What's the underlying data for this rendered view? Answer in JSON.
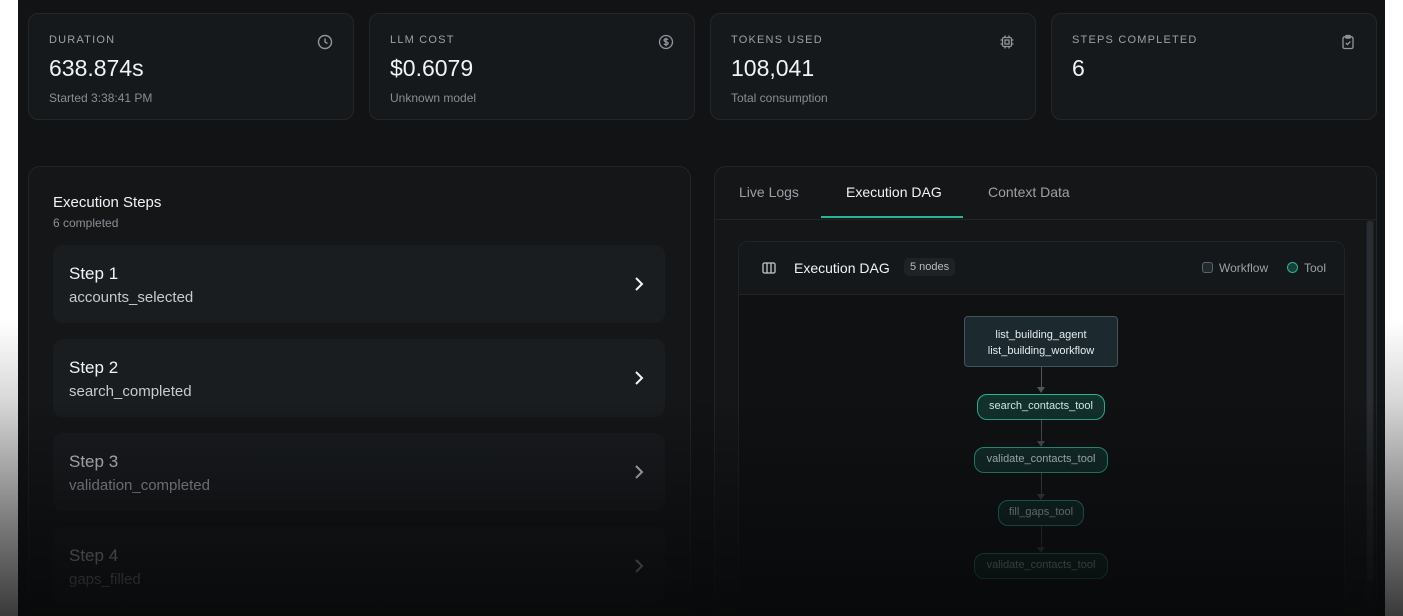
{
  "stats": [
    {
      "label": "DURATION",
      "value": "638.874s",
      "sub": "Started 3:38:41 PM",
      "icon": "clock-icon"
    },
    {
      "label": "LLM COST",
      "value": "$0.6079",
      "sub": "Unknown model",
      "icon": "dollar-icon"
    },
    {
      "label": "TOKENS USED",
      "value": "108,041",
      "sub": "Total consumption",
      "icon": "cpu-icon"
    },
    {
      "label": "STEPS COMPLETED",
      "value": "6",
      "sub": "",
      "icon": "clipboard-check-icon"
    }
  ],
  "steps_panel": {
    "title": "Execution Steps",
    "subtitle": "6 completed",
    "steps": [
      {
        "title": "Step 1",
        "sub": "accounts_selected"
      },
      {
        "title": "Step 2",
        "sub": "search_completed"
      },
      {
        "title": "Step 3",
        "sub": "validation_completed"
      },
      {
        "title": "Step 4",
        "sub": "gaps_filled"
      }
    ]
  },
  "tabs": [
    {
      "label": "Live Logs"
    },
    {
      "label": "Execution DAG"
    },
    {
      "label": "Context Data"
    }
  ],
  "dag": {
    "title": "Execution DAG",
    "count": "5 nodes",
    "legend": [
      {
        "label": "Workflow"
      },
      {
        "label": "Tool"
      }
    ],
    "nodes": [
      {
        "line1": "list_building_agent",
        "line2": "list_building_workflow",
        "kind": "workflow"
      },
      {
        "line1": "search_contacts_tool",
        "kind": "tool"
      },
      {
        "line1": "validate_contacts_tool",
        "kind": "tool"
      },
      {
        "line1": "fill_gaps_tool",
        "kind": "tool"
      },
      {
        "line1": "validate_contacts_tool",
        "kind": "tool"
      }
    ]
  },
  "colors": {
    "accent": "#2bb39a",
    "background": "#111315",
    "card": "#16191b"
  }
}
